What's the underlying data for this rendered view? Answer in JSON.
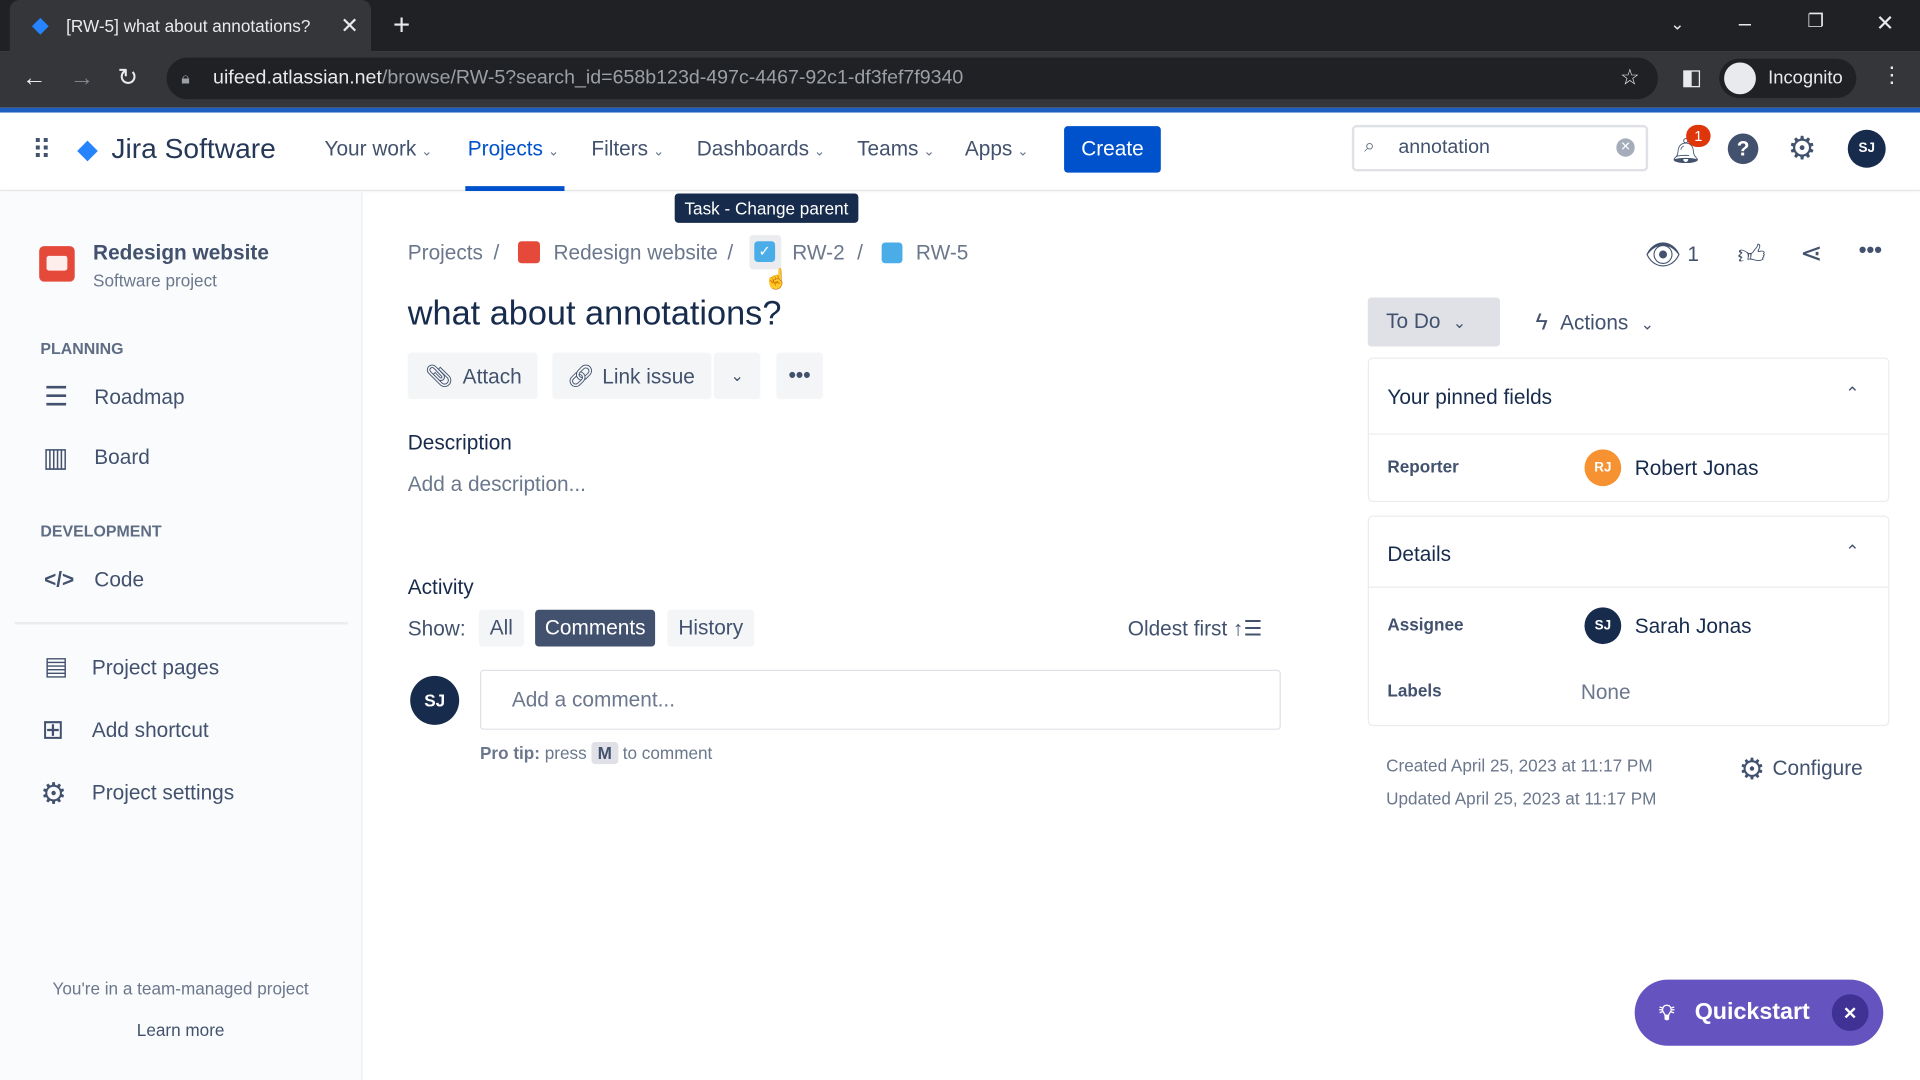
{
  "browser": {
    "tab_title": "[RW-5] what about annotations?",
    "url_host": "uifeed.atlassian.net",
    "url_path": "/browse/RW-5?search_id=658b123d-497c-4467-92c1-df3fef7f9340",
    "profile": "Incognito"
  },
  "header": {
    "product": "Jira Software",
    "nav": [
      "Your work",
      "Projects",
      "Filters",
      "Dashboards",
      "Teams",
      "Apps"
    ],
    "active_nav": "Projects",
    "create": "Create",
    "search_value": "annotation",
    "notification_count": "1",
    "user_initials": "SJ",
    "accent": "#0052cc"
  },
  "sidebar": {
    "project_name": "Redesign website",
    "project_type": "Software project",
    "planning_label": "PLANNING",
    "planning": [
      "Roadmap",
      "Board"
    ],
    "development_label": "DEVELOPMENT",
    "development": [
      "Code"
    ],
    "links": [
      "Project pages",
      "Add shortcut",
      "Project settings"
    ],
    "footer": "You're in a team-managed project",
    "learn_more": "Learn more"
  },
  "tooltip": "Task - Change parent",
  "breadcrumb": [
    "Projects",
    "Redesign website",
    "RW-2",
    "RW-5"
  ],
  "issue": {
    "title": "what about annotations?",
    "attach": "Attach",
    "link_issue": "Link issue",
    "description_label": "Description",
    "description_placeholder": "Add a description...",
    "activity_label": "Activity",
    "show_label": "Show:",
    "filters": [
      "All",
      "Comments",
      "History"
    ],
    "active_filter": "Comments",
    "sort": "Oldest first",
    "comment_placeholder": "Add a comment...",
    "commenter_initials": "SJ",
    "tip_prefix": "Pro tip:",
    "tip_press": "press",
    "tip_key": "M",
    "tip_suffix": "to comment"
  },
  "right": {
    "watchers": "1",
    "status": "To Do",
    "actions": "Actions",
    "pinned_title": "Your pinned fields",
    "reporter_label": "Reporter",
    "reporter": "Robert Jonas",
    "reporter_initials": "RJ",
    "details_title": "Details",
    "assignee_label": "Assignee",
    "assignee": "Sarah Jonas",
    "assignee_initials": "SJ",
    "labels_label": "Labels",
    "labels": "None",
    "created": "Created April 25, 2023 at 11:17 PM",
    "updated": "Updated April 25, 2023 at 11:17 PM",
    "configure": "Configure"
  },
  "quickstart": {
    "label": "Quickstart",
    "color": "#6554c0"
  }
}
